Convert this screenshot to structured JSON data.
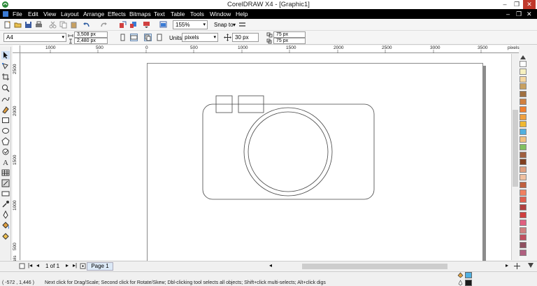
{
  "window": {
    "title": "CorelDRAW X4 - [Graphic1]",
    "minimize_label": "–",
    "restore_label": "❐",
    "close_label": "✕"
  },
  "menu": {
    "items": [
      "File",
      "Edit",
      "View",
      "Layout",
      "Arrange",
      "Effects",
      "Bitmaps",
      "Text",
      "Table",
      "Tools",
      "Window",
      "Help"
    ],
    "right_min": "–",
    "right_restore": "❐",
    "right_close": "✕"
  },
  "standard_toolbar": {
    "zoom_value": "155%",
    "snap_label": "Snap to",
    "snap_arrow": "▾"
  },
  "property_bar": {
    "paper_size": "A4",
    "page_width": "3,508 px",
    "page_height": "2,480 px",
    "units_label": "Units:",
    "units_value": "pixels",
    "nudge_value": "30 px",
    "dup_x": "75 px",
    "dup_y": "75 px"
  },
  "rulers": {
    "horizontal_labels": [
      "1000",
      "500",
      "0",
      "500",
      "1000",
      "1500",
      "2000",
      "2500",
      "3000",
      "3500"
    ],
    "units_label": "pixels",
    "vertical_labels": [
      "2500",
      "2000",
      "1500",
      "1000",
      "500"
    ],
    "vertical_units": "pixels"
  },
  "document_nav": {
    "page_count": "1 of 1",
    "page_tab": "Page 1"
  },
  "palette_colors": [
    "#ffffff",
    "#f6f0c0",
    "#f4d6a0",
    "#c8a060",
    "#a07040",
    "#d08040",
    "#f08030",
    "#f0a040",
    "#f0b830",
    "#50b0e0",
    "#f0c080",
    "#80c060",
    "#a06040",
    "#804020",
    "#e0a080",
    "#f0c0a0",
    "#c06040",
    "#f08060",
    "#e06050",
    "#b04040",
    "#d04040",
    "#e06080",
    "#d08080",
    "#c05060",
    "#905060",
    "#b06080"
  ],
  "status": {
    "coords": "( -572 , 1,446 )",
    "hint": "Next click for Drag/Scale; Second click for Rotate/Skew; Dbl-clicking tool selects all objects; Shift+click multi-selects; Alt+click digs",
    "fill_color": "#50b0e0",
    "outline_color": "#1a1a1a"
  }
}
